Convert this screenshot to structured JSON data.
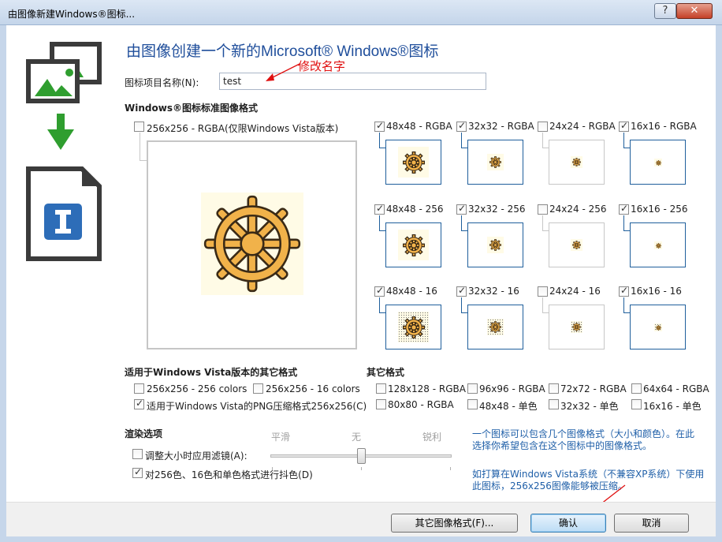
{
  "window": {
    "title": "由图像新建Windows®图标...",
    "help_button": "?",
    "close_button": "✕"
  },
  "heading": "由图像创建一个新的Microsoft® Windows®图标",
  "name_field": {
    "label": "图标项目名称(N):",
    "value": "test"
  },
  "annotation": "修改名字",
  "standard_section": {
    "title": "Windows®图标标准图像格式",
    "large": {
      "label": "256x256 - RGBA(仅限Windows Vista版本)",
      "checked": false
    },
    "formats": [
      {
        "label": "48x48 - RGBA",
        "checked": true
      },
      {
        "label": "32x32 - RGBA",
        "checked": true
      },
      {
        "label": "24x24 - RGBA",
        "checked": false
      },
      {
        "label": "16x16 - RGBA",
        "checked": true
      },
      {
        "label": "48x48 - 256",
        "checked": true
      },
      {
        "label": "32x32 - 256",
        "checked": true
      },
      {
        "label": "24x24 - 256",
        "checked": false
      },
      {
        "label": "16x16 - 256",
        "checked": true
      },
      {
        "label": "48x48 - 16",
        "checked": true
      },
      {
        "label": "32x32 - 16",
        "checked": true
      },
      {
        "label": "24x24 - 16",
        "checked": false
      },
      {
        "label": "16x16 - 16",
        "checked": true
      }
    ]
  },
  "vista_section": {
    "title": "适用于Windows Vista版本的其它格式",
    "items": [
      {
        "label": "256x256 - 256 colors",
        "checked": false
      },
      {
        "label": "256x256 - 16 colors",
        "checked": false
      },
      {
        "label": "适用于Windows Vista的PNG压缩格式256x256(C)",
        "checked": true
      }
    ]
  },
  "other_section": {
    "title": "其它格式",
    "items": [
      {
        "label": "128x128 - RGBA",
        "checked": false
      },
      {
        "label": "96x96 - RGBA",
        "checked": false
      },
      {
        "label": "72x72 - RGBA",
        "checked": false
      },
      {
        "label": "64x64 - RGBA",
        "checked": false
      },
      {
        "label": "80x80 - RGBA",
        "checked": false
      },
      {
        "label": "48x48 - 单色",
        "checked": false
      },
      {
        "label": "32x32 - 单色",
        "checked": false
      },
      {
        "label": "16x16 - 单色",
        "checked": false
      }
    ]
  },
  "render_section": {
    "title": "渲染选项",
    "items": [
      {
        "label": "调整大小时应用滤镜(A):",
        "checked": false
      },
      {
        "label": "对256色、16色和单色格式进行抖色(D)",
        "checked": true
      }
    ],
    "slider": {
      "left_label": "平滑",
      "middle_label": "无",
      "right_label": "锐利",
      "position": 0.5
    }
  },
  "info_text_1": "一个图标可以包含几个图像格式（大小和颜色）。在此选择你希望包含在这个图标中的图像格式。",
  "info_text_1_lines": [
    "一个图标可以包含几个图像格式（大小和颜色）。在此",
    "选择你希望包含在这个图标中的图像格式。"
  ],
  "info_text_2_lines": [
    "如打算在Windows Vista系统（不兼容XP系统）下使用",
    "此图标，256x256图像能够被压缩。"
  ],
  "buttons": {
    "other_formats": "其它图像格式(F)...",
    "ok": "确认",
    "cancel": "取消"
  },
  "colors": {
    "heading": "#1f4e9b",
    "info": "#1f5fa8",
    "annotation": "#e01010",
    "wheel": "#f1b24a",
    "wheel_outline": "#3a2a16"
  }
}
